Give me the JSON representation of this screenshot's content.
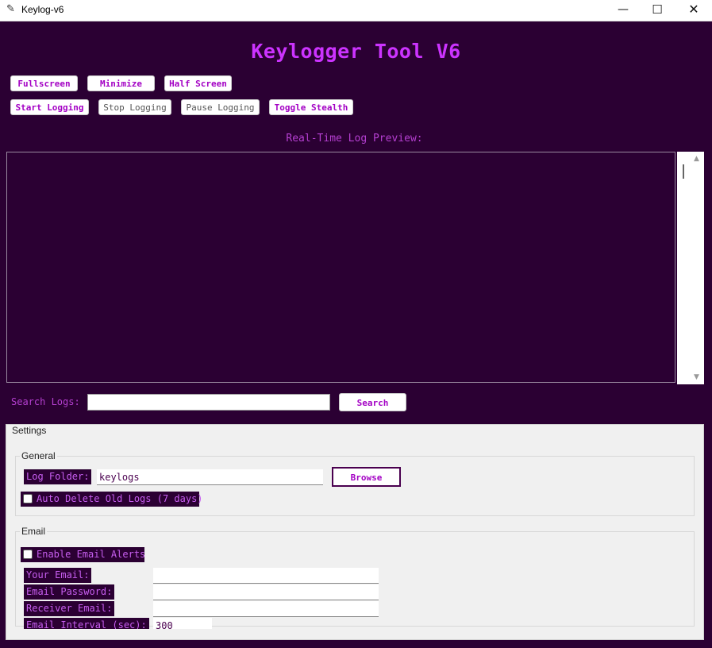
{
  "window": {
    "title": "Keylog-v6",
    "icon": "feather-icon",
    "controls": {
      "minimize": "—",
      "maximize": "☐",
      "close": "✕"
    }
  },
  "app": {
    "heading": "Keylogger Tool V6"
  },
  "view_buttons": {
    "fullscreen": "Fullscreen",
    "minimize": "Minimize",
    "half_screen": "Half Screen"
  },
  "logging_buttons": {
    "start": "Start Logging",
    "stop": "Stop Logging",
    "pause": "Pause Logging",
    "stealth": "Toggle Stealth"
  },
  "preview": {
    "label": "Real-Time Log Preview:",
    "content": ""
  },
  "search": {
    "label": "Search Logs:",
    "value": "",
    "button": "Search"
  },
  "settings": {
    "title": "Settings",
    "general": {
      "title": "General",
      "log_folder_label": "Log Folder:",
      "log_folder_value": "keylogs",
      "browse_button": "Browse",
      "auto_delete_label": "Auto Delete Old Logs (7 days)",
      "auto_delete_checked": false
    },
    "email": {
      "title": "Email",
      "enable_label": "Enable Email Alerts",
      "enable_checked": false,
      "your_email_label": "Your Email:",
      "your_email_value": "",
      "password_label": "Email Password:",
      "password_value": "",
      "receiver_label": "Receiver Email:",
      "receiver_value": "",
      "interval_label": "Email Interval (sec):",
      "interval_value": "300"
    }
  },
  "colors": {
    "background": "#2b0033",
    "accent": "#cc33ff",
    "button_text": "#a300c4",
    "panel": "#f0f0f0"
  }
}
